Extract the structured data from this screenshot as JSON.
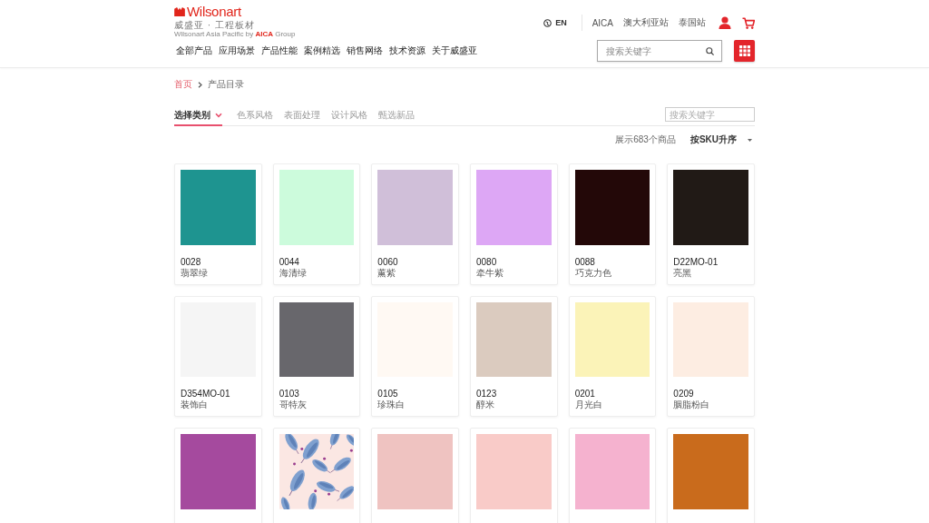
{
  "header": {
    "logo": {
      "brand": "Wilsonart",
      "tagline": "威盛亚 · 工程板材",
      "subline": "Wilsonart Asia Pacific by **AICA** Group"
    },
    "language": "EN",
    "site_links": [
      "AICA",
      "澳大利亚站",
      "泰国站"
    ],
    "nav": [
      "全部产品",
      "应用场景",
      "产品性能",
      "案例精选",
      "销售网络",
      "技术资源",
      "关于威盛亚"
    ],
    "search": {
      "placeholder": "搜索关键字"
    }
  },
  "breadcrumb": [
    {
      "label": "首页",
      "current": false
    },
    {
      "label": "产品目录",
      "current": true
    }
  ],
  "filter_tabs": [
    {
      "label": "选择类别",
      "kind": "dropdown",
      "selected": true
    },
    {
      "label": "色系风格",
      "kind": "option",
      "selected": false
    },
    {
      "label": "表面处理",
      "kind": "option",
      "selected": false
    },
    {
      "label": "设计风格",
      "kind": "option",
      "selected": false
    },
    {
      "label": "甄选新品",
      "kind": "option",
      "selected": false
    }
  ],
  "filter_search": {
    "placeholder": "搜索关键字"
  },
  "result_count": "展示683个商品",
  "sort": {
    "value": "按SKU升序"
  },
  "products": [
    {
      "kind": "solid",
      "color": "#1e9490",
      "code": "0028",
      "name": "翡翠绿"
    },
    {
      "kind": "solid",
      "color": "#ccfbdc",
      "code": "0044",
      "name": "海清绿"
    },
    {
      "kind": "solid",
      "color": "#d0bfd9",
      "code": "0060",
      "name": "薰紫"
    },
    {
      "kind": "solid",
      "color": "#dda7f5",
      "code": "0080",
      "name": "牵牛紫"
    },
    {
      "kind": "solid",
      "color": "#230808",
      "code": "0088",
      "name": "巧克力色"
    },
    {
      "kind": "solid",
      "color": "#211a16",
      "code": "D22MO-01",
      "name": "亮黑"
    },
    {
      "kind": "solid",
      "color": "#f5f5f5",
      "code": "D354MO-01",
      "name": "装饰白"
    },
    {
      "kind": "solid",
      "color": "#68676c",
      "code": "0103",
      "name": "哥特灰"
    },
    {
      "kind": "solid",
      "color": "#fff9f3",
      "code": "0105",
      "name": "珍珠白"
    },
    {
      "kind": "solid",
      "color": "#dbcbbf",
      "code": "0123",
      "name": "醇米"
    },
    {
      "kind": "solid",
      "color": "#fbf3b8",
      "code": "0201",
      "name": "月光白"
    },
    {
      "kind": "solid",
      "color": "#fdede2",
      "code": "0209",
      "name": "胭脂粉白"
    },
    {
      "kind": "solid",
      "color": "#a54a9e"
    },
    {
      "kind": "pattern"
    },
    {
      "kind": "solid",
      "color": "#efc3c1"
    },
    {
      "kind": "solid",
      "color": "#f9cbc8"
    },
    {
      "kind": "solid",
      "color": "#f5b2cf"
    },
    {
      "kind": "solid",
      "color": "#c96b1c"
    }
  ]
}
